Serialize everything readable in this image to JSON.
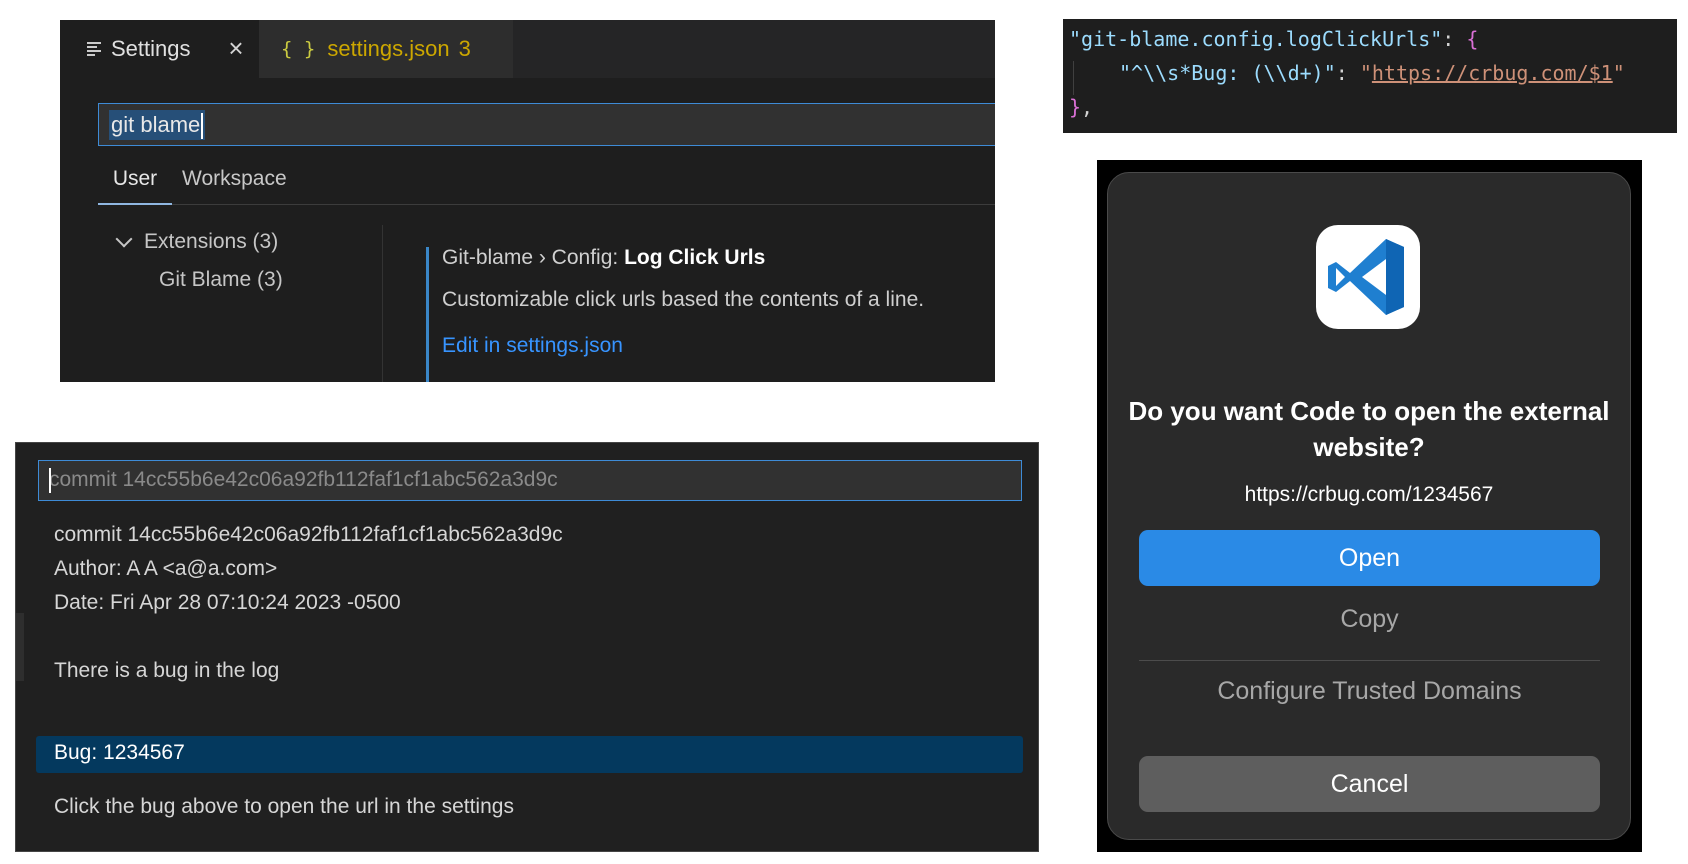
{
  "settings_panel": {
    "tab_settings_label": "Settings",
    "tab_json_label": "settings.json",
    "tab_json_count": "3",
    "tab_json_icon": "{ }",
    "search_value": "git blame",
    "scope_tabs": {
      "user": "User",
      "workspace": "Workspace"
    },
    "toc": {
      "extensions": "Extensions (3)",
      "git_blame": "Git Blame (3)"
    },
    "setting": {
      "category": "Git-blame › Config: ",
      "name": "Log Click Urls",
      "description": "Customizable click urls based the contents of a line.",
      "edit_link": "Edit in settings.json"
    }
  },
  "json_snippet": {
    "key": "\"git-blame.config.logClickUrls\"",
    "colon": ": ",
    "open_brace": "{",
    "pattern": "\"^\\\\s*Bug: (\\\\d+)\"",
    "url_quote_open": "\"",
    "url": "https://crbug.com/$1",
    "url_quote_close": "\"",
    "close_brace": "}",
    "trailing_comma": ","
  },
  "commit_panel": {
    "input_value": "commit 14cc55b6e42c06a92fb112faf1cf1abc562a3d9c",
    "lines": {
      "commit": "commit 14cc55b6e42c06a92fb112faf1cf1abc562a3d9c",
      "author": "Author: A A <a@a.com>",
      "date": "Date: Fri Apr 28 07:10:24 2023 -0500",
      "message": "There is a bug in the log",
      "bug": "Bug: 1234567",
      "hint": "Click the bug above to open the url in the settings"
    }
  },
  "dialog": {
    "app_icon": "vscode-icon",
    "title": "Do you want Code to open the external website?",
    "url": "https://crbug.com/1234567",
    "buttons": {
      "open": "Open",
      "copy": "Copy",
      "configure": "Configure Trusted Domains",
      "cancel": "Cancel"
    }
  },
  "colors": {
    "accent_blue": "#2a8ae6",
    "link_blue": "#3794ff",
    "selection": "#04395e",
    "json_tab_yellow": "#cca700"
  }
}
